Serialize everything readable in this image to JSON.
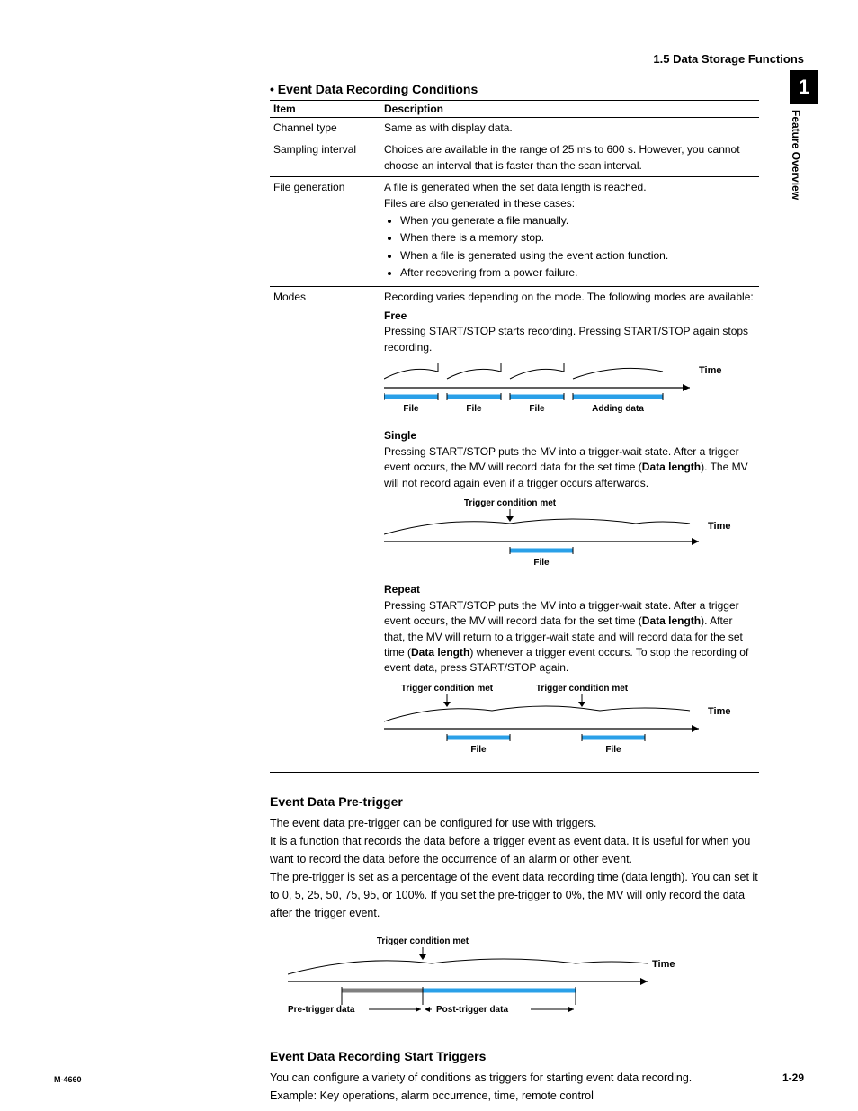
{
  "header": {
    "section": "1.5  Data Storage Functions"
  },
  "sidetab": {
    "num": "1",
    "title": "Feature Overview"
  },
  "sec1": {
    "heading": "Event Data Recording Conditions",
    "th_item": "Item",
    "th_desc": "Description",
    "r1_item": "Channel type",
    "r1_desc": "Same as with display data.",
    "r2_item": "Sampling interval",
    "r2_desc": "Choices are available in the range of 25 ms to 600 s. However, you cannot choose an interval that is faster than the scan interval.",
    "r3_item": "File generation",
    "r3_l1": "A file is generated when the set data length is reached.",
    "r3_l2": "Files are also generated in these cases:",
    "r3_b1": "When you generate a file manually.",
    "r3_b2": "When there is a memory stop.",
    "r3_b3": "When a file is generated using the event action function.",
    "r3_b4": "After recovering from a power failure.",
    "r4_item": "Modes",
    "r4_intro": "Recording varies depending on the mode. The following modes are available:",
    "free_name": "Free",
    "free_desc": "Pressing START/STOP starts recording. Pressing START/STOP again stops recording.",
    "single_name": "Single",
    "single_desc_a": "Pressing START/STOP puts the MV into a trigger-wait state. After a trigger event occurs, the MV will record data for the set time (",
    "single_desc_b": "Data length",
    "single_desc_c": "). The MV will not record again even if a trigger occurs afterwards.",
    "repeat_name": "Repeat",
    "repeat_desc_a": "Pressing START/STOP puts the MV into a trigger-wait state. After a trigger event occurs, the MV will record data for the set time (",
    "repeat_desc_b": "Data length",
    "repeat_desc_c": "). After that, the MV will return to a trigger-wait state and will record data for the set time (",
    "repeat_desc_d": "Data length",
    "repeat_desc_e": ") whenever a trigger event occurs. To stop the recording of event data, press START/STOP again."
  },
  "diag": {
    "time": "Time",
    "file": "File",
    "adding": "Adding data",
    "trigger_met": "Trigger condition met",
    "pre_trigger": "Pre-trigger data",
    "post_trigger": "Post-trigger data"
  },
  "sec2": {
    "heading": "Event Data Pre-trigger",
    "p1": "The event data pre-trigger can be configured for use with triggers.",
    "p2": "It is a function that records the data before a trigger event as event data. It is useful for when you want to record the data before the occurrence of an alarm or other event.",
    "p3": "The pre-trigger is set as a percentage of the event data recording time (data length). You can set it to 0, 5, 25, 50, 75, 95, or 100%. If you set the pre-trigger to 0%, the MV will only record the data after the trigger event."
  },
  "sec3": {
    "heading": "Event Data Recording Start Triggers",
    "p1": "You can configure a variety of conditions as triggers for starting event data recording.",
    "p2": "Example: Key operations, alarm occurrence, time, remote control"
  },
  "footer": {
    "left": "M-4660",
    "right": "1-29"
  }
}
